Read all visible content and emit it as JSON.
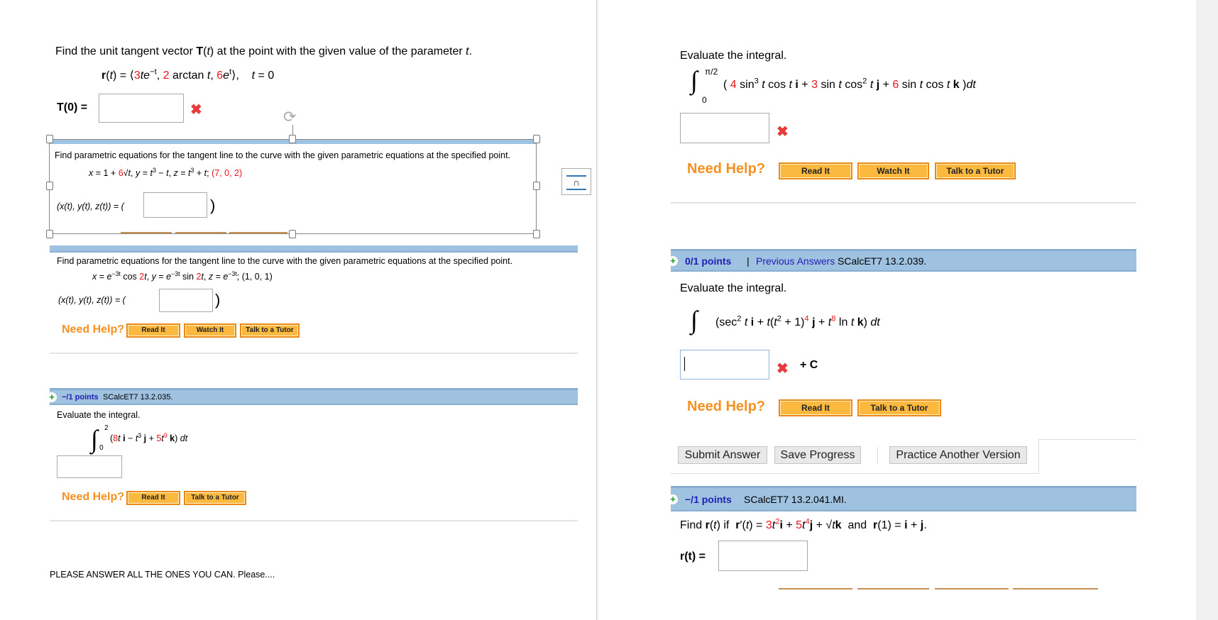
{
  "left": {
    "p1": {
      "prompt": [
        {
          "t": "Find the unit tangent vector "
        },
        {
          "t": "T",
          "s": "b"
        },
        {
          "t": "("
        },
        {
          "t": "t",
          "s": "i"
        },
        {
          "t": ") at the point with the given value of the parameter "
        },
        {
          "t": "t",
          "s": "i"
        },
        {
          "t": "."
        }
      ],
      "equation": [
        {
          "t": "r",
          "s": "b"
        },
        {
          "t": "("
        },
        {
          "t": "t",
          "s": "i"
        },
        {
          "t": ") = ⟨"
        },
        {
          "t": "3",
          "s": "r"
        },
        {
          "t": "te",
          "s": "i"
        },
        {
          "t": "−t",
          "s": "u"
        },
        {
          "t": ", "
        },
        {
          "t": "2",
          "s": "r"
        },
        {
          "t": " arctan "
        },
        {
          "t": "t",
          "s": "i"
        },
        {
          "t": ", "
        },
        {
          "t": "6",
          "s": "r"
        },
        {
          "t": "e",
          "s": "i"
        },
        {
          "t": "t",
          "s": "u"
        },
        {
          "t": "⟩,    "
        },
        {
          "t": "t",
          "s": "i"
        },
        {
          "t": " = 0"
        }
      ],
      "answer_label": "T(0) =",
      "answer_value": ""
    },
    "p2": {
      "prompt": "Find parametric equations for the tangent line to the curve with the given parametric equations at the specified point.",
      "equation": [
        {
          "t": "x",
          "s": "i"
        },
        {
          "t": " = 1 + "
        },
        {
          "t": "6",
          "s": "r"
        },
        {
          "t": "√"
        },
        {
          "t": "t",
          "s": "i"
        },
        {
          "t": ", "
        },
        {
          "t": "y",
          "s": "i"
        },
        {
          "t": " = "
        },
        {
          "t": "t",
          "s": "i"
        },
        {
          "t": "3",
          "s": "u"
        },
        {
          "t": " − "
        },
        {
          "t": "t",
          "s": "i"
        },
        {
          "t": ", "
        },
        {
          "t": "z",
          "s": "i"
        },
        {
          "t": " = "
        },
        {
          "t": "t",
          "s": "i"
        },
        {
          "t": "3",
          "s": "u"
        },
        {
          "t": " + "
        },
        {
          "t": "t",
          "s": "i"
        },
        {
          "t": "; "
        },
        {
          "t": "(7, 0, 2)",
          "s": "r"
        }
      ],
      "answer_label": "(x(t), y(t), z(t)) = (",
      "answer_close": ")",
      "answer_value": ""
    },
    "p3": {
      "prompt": "Find parametric equations for the tangent line to the curve with the given parametric equations at the specified point.",
      "equation": [
        {
          "t": "x",
          "s": "i"
        },
        {
          "t": " = "
        },
        {
          "t": "e",
          "s": "i"
        },
        {
          "t": "−3t",
          "s": "u"
        },
        {
          "t": " cos "
        },
        {
          "t": "2",
          "s": "r"
        },
        {
          "t": "t",
          "s": "i"
        },
        {
          "t": ", "
        },
        {
          "t": "y",
          "s": "i"
        },
        {
          "t": " = "
        },
        {
          "t": "e",
          "s": "i"
        },
        {
          "t": "−3t",
          "s": "u"
        },
        {
          "t": " sin "
        },
        {
          "t": "2",
          "s": "r"
        },
        {
          "t": "t",
          "s": "i"
        },
        {
          "t": ", "
        },
        {
          "t": "z",
          "s": "i"
        },
        {
          "t": " = "
        },
        {
          "t": "e",
          "s": "i"
        },
        {
          "t": "−3t",
          "s": "u"
        },
        {
          "t": "; (1, 0, 1)"
        }
      ],
      "answer_label": "(x(t), y(t), z(t)) = (",
      "answer_close": ")",
      "answer_value": "",
      "need_help": "Need Help?",
      "buttons": [
        "Read It",
        "Watch It",
        "Talk to a Tutor"
      ]
    },
    "p4": {
      "points": "−/1 points",
      "code": "SCalcET7 13.2.035.",
      "prompt": "Evaluate the integral.",
      "upper": "2",
      "lower": "0",
      "equation": [
        {
          "t": "("
        },
        {
          "t": "8",
          "s": "r"
        },
        {
          "t": "t",
          "s": "i"
        },
        {
          "t": " i",
          "s": "b"
        },
        {
          "t": " − "
        },
        {
          "t": "t",
          "s": "i"
        },
        {
          "t": "3",
          "s": "u"
        },
        {
          "t": " j",
          "s": "b"
        },
        {
          "t": " + "
        },
        {
          "t": "5",
          "s": "r"
        },
        {
          "t": "t",
          "s": "i"
        },
        {
          "t": "9",
          "s": "u r"
        },
        {
          "t": " k",
          "s": "b"
        },
        {
          "t": ") "
        },
        {
          "t": "dt",
          "s": "i"
        }
      ],
      "answer_value": "",
      "need_help": "Need Help?",
      "buttons": [
        "Read It",
        "Talk to a Tutor"
      ]
    },
    "footer_note": "PLEASE ANSWER ALL THE ONES YOU CAN. Please...."
  },
  "right": {
    "q1": {
      "prompt": "Evaluate the integral.",
      "upper": "π/2",
      "lower": "0",
      "equation": [
        {
          "t": "( "
        },
        {
          "t": "4",
          "s": "r"
        },
        {
          "t": " sin"
        },
        {
          "t": "3",
          "s": "u"
        },
        {
          "t": " t",
          "s": "i"
        },
        {
          "t": " cos "
        },
        {
          "t": "t",
          "s": "i"
        },
        {
          "t": " i",
          "s": "b"
        },
        {
          "t": " + "
        },
        {
          "t": "3",
          "s": "r"
        },
        {
          "t": " sin "
        },
        {
          "t": "t",
          "s": "i"
        },
        {
          "t": " cos"
        },
        {
          "t": "2",
          "s": "u"
        },
        {
          "t": " t",
          "s": "i"
        },
        {
          "t": " j",
          "s": "b"
        },
        {
          "t": " + "
        },
        {
          "t": "6",
          "s": "r"
        },
        {
          "t": " sin "
        },
        {
          "t": "t",
          "s": "i"
        },
        {
          "t": " cos "
        },
        {
          "t": "t",
          "s": "i"
        },
        {
          "t": " k",
          "s": "b"
        },
        {
          "t": " )"
        },
        {
          "t": "dt",
          "s": "i"
        }
      ],
      "answer_value": "",
      "need_help": "Need Help?",
      "buttons": [
        "Read It",
        "Watch It",
        "Talk to a Tutor"
      ]
    },
    "q2": {
      "points": "0/1 points",
      "separator": "|",
      "previous": "Previous Answers",
      "code": "SCalcET7 13.2.039.",
      "prompt": "Evaluate the integral.",
      "equation": [
        {
          "t": "(sec"
        },
        {
          "t": "2",
          "s": "u"
        },
        {
          "t": " t",
          "s": "i"
        },
        {
          "t": " i",
          "s": "b"
        },
        {
          "t": " + "
        },
        {
          "t": "t",
          "s": "i"
        },
        {
          "t": "("
        },
        {
          "t": "t",
          "s": "i"
        },
        {
          "t": "2",
          "s": "u"
        },
        {
          "t": " + 1)"
        },
        {
          "t": "4",
          "s": "u r"
        },
        {
          "t": " j",
          "s": "b"
        },
        {
          "t": " + "
        },
        {
          "t": "t",
          "s": "i"
        },
        {
          "t": "8",
          "s": "u r"
        },
        {
          "t": " ln "
        },
        {
          "t": "t",
          "s": "i"
        },
        {
          "t": " k",
          "s": "b"
        },
        {
          "t": ") "
        },
        {
          "t": "dt",
          "s": "i"
        }
      ],
      "answer_value": "",
      "plus_c": "+ C",
      "need_help": "Need Help?",
      "buttons": [
        "Read It",
        "Talk to a Tutor"
      ]
    },
    "actions": {
      "submit": "Submit Answer",
      "save": "Save Progress",
      "practice": "Practice Another Version"
    },
    "q3": {
      "points": "−/1 points",
      "code": "SCalcET7 13.2.041.MI.",
      "prompt": [
        {
          "t": "Find "
        },
        {
          "t": "r",
          "s": "b"
        },
        {
          "t": "("
        },
        {
          "t": "t",
          "s": "i"
        },
        {
          "t": ") if  "
        },
        {
          "t": "r",
          "s": "b"
        },
        {
          "t": "′("
        },
        {
          "t": "t",
          "s": "i"
        },
        {
          "t": ") = "
        },
        {
          "t": "3",
          "s": "r"
        },
        {
          "t": "t",
          "s": "i"
        },
        {
          "t": "2",
          "s": "u r"
        },
        {
          "t": "i",
          "s": "b"
        },
        {
          "t": " + "
        },
        {
          "t": "5",
          "s": "r"
        },
        {
          "t": "t",
          "s": "i"
        },
        {
          "t": "4",
          "s": "u r"
        },
        {
          "t": "j",
          "s": "b"
        },
        {
          "t": " + √"
        },
        {
          "t": "t",
          "s": "i"
        },
        {
          "t": "k",
          "s": "b"
        },
        {
          "t": "  and  "
        },
        {
          "t": "r",
          "s": "b"
        },
        {
          "t": "(1) = "
        },
        {
          "t": "i",
          "s": "b"
        },
        {
          "t": " + "
        },
        {
          "t": "j",
          "s": "b"
        },
        {
          "t": "."
        }
      ],
      "answer_label": "r(t) =",
      "answer_value": ""
    }
  },
  "colors": {
    "accent_red": "#e8131b",
    "need_help": "#f7901e",
    "header_bar": "#9fc2e0",
    "button_orange": "#fbb940"
  }
}
